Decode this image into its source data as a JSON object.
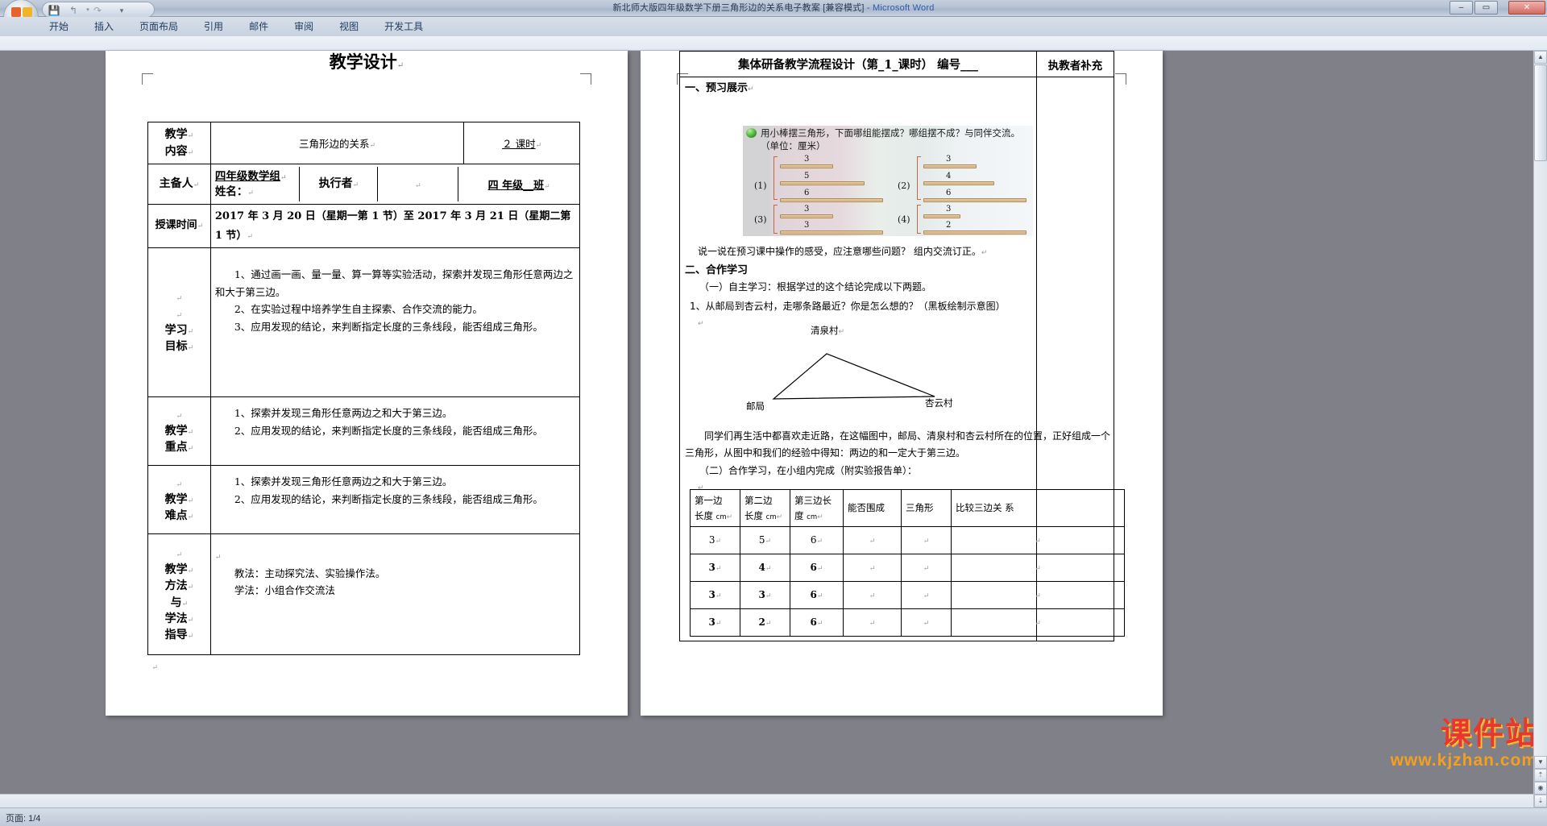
{
  "window": {
    "title_cn": "新北师大版四年级数学下册三角形边的关系电子教案 [兼容模式]",
    "title_sep": " - ",
    "title_app": "Microsoft Word",
    "minimize": "–",
    "maximize": "▭",
    "close": "✕"
  },
  "quick_access": {
    "office_button": "office-orb",
    "save": "💾",
    "undo": "↰",
    "undo_dropdown": "▾",
    "redo": "↷",
    "customize": "▾"
  },
  "ribbon": {
    "tabs": [
      {
        "label": "开始"
      },
      {
        "label": "插入"
      },
      {
        "label": "页面布局"
      },
      {
        "label": "引用"
      },
      {
        "label": "邮件"
      },
      {
        "label": "审阅"
      },
      {
        "label": "视图"
      },
      {
        "label": "开发工具"
      }
    ]
  },
  "status": {
    "page_info": "页面: 1/4"
  },
  "watermark": {
    "main": "课件站",
    "sub": "www.kjzhan.com"
  },
  "scroll": {
    "up": "▲",
    "down": "▼",
    "prev_page": "⇡",
    "select_browse": "◉",
    "next_page": "⇣"
  },
  "left_page": {
    "title": "教学设计",
    "pilcrow": "↵",
    "rows": {
      "content_label": "教学\n内容",
      "content_value": "三角形边的关系",
      "periods_value": "２ 课时",
      "author_label": "主备人",
      "author_value_line1": "四年级数学组",
      "author_value_line2": "姓名：",
      "executor_label": "执行者",
      "executor_value": "",
      "grade_value": "四  年级__班",
      "time_label": "授课时间",
      "time_value": "2017 年 3 月 20 日（星期一第 1 节）至 2017 年 3 月 21 日（星期二第 1 节）",
      "goal_label": "学习\n目标",
      "goal_items": [
        "1、通过画一画、量一量、算一算等实验活动，探索并发现三角形任意两边之和大于第三边。",
        "2、在实验过程中培养学生自主探索、合作交流的能力。",
        "3、应用发现的结论，来判断指定长度的三条线段，能否组成三角形。"
      ],
      "focus_label": "教学\n重点",
      "focus_items": [
        "1、探索并发现三角形任意两边之和大于第三边。",
        "2、应用发现的结论，来判断指定长度的三条线段，能否组成三角形。"
      ],
      "difficulty_label": "教学\n难点",
      "difficulty_items": [
        "1、探索并发现三角形任意两边之和大于第三边。",
        "2、应用发现的结论，来判断指定长度的三条线段，能否组成三角形。"
      ],
      "method_label": "教学\n方法\n与\n学法\n指导",
      "method_items": [
        "教法：主动探究法、实验操作法。",
        "学法：小组合作交流法"
      ]
    }
  },
  "right_page": {
    "header_title": "集体研备教学流程设计（第_1_课时）     编号___",
    "header_side": "执教者补充",
    "sec1_title": "一、预习展示",
    "illus": {
      "line1": "用小棒摆三角形，下面哪组能摆成？哪组摆不成？与同伴交流。",
      "line2": "（单位：厘米）",
      "groups": [
        {
          "tag": "(1)",
          "values": [
            3,
            5,
            6
          ]
        },
        {
          "tag": "(2)",
          "values": [
            3,
            4,
            6
          ]
        },
        {
          "tag": "(3)",
          "values": [
            3,
            3,
            6
          ]
        },
        {
          "tag": "(4)",
          "values": [
            3,
            2,
            6
          ]
        }
      ]
    },
    "after_illus": "说一说在预习课中操作的感受，应注意哪些问题？      组内交流订正。",
    "sec2_title": "二、合作学习",
    "sec2_a": "（一）自主学习：根据学过的这个结论完成以下两题。",
    "sec2_q1": "1、从邮局到杏云村，走哪条路最近？你是怎么想的？（黑板绘制示意图）",
    "map_labels": {
      "top": "清泉村",
      "left": "邮局",
      "right": "杏云村"
    },
    "sec2_p1": "同学们再生活中都喜欢走近路，在这幅图中，邮局、清泉村和杏云村所在的位置，正好组成一个三角形，从图中和我们的经验中得知：两边的和一定大于第三边。",
    "sec2_b": "（二）合作学习，在小组内完成（附实验报告单）：",
    "table": {
      "headers": [
        "第一边\n长度 cm",
        "第二边\n长度 cm",
        "第三边长\n度 cm",
        "能否围成",
        "三角形",
        "比较三边关 系"
      ],
      "rows": [
        [
          "3",
          "5",
          "6",
          "",
          "",
          ""
        ],
        [
          "3",
          "4",
          "6",
          "",
          "",
          ""
        ],
        [
          "3",
          "3",
          "6",
          "",
          "",
          ""
        ],
        [
          "3",
          "2",
          "6",
          "",
          "",
          ""
        ]
      ]
    }
  }
}
